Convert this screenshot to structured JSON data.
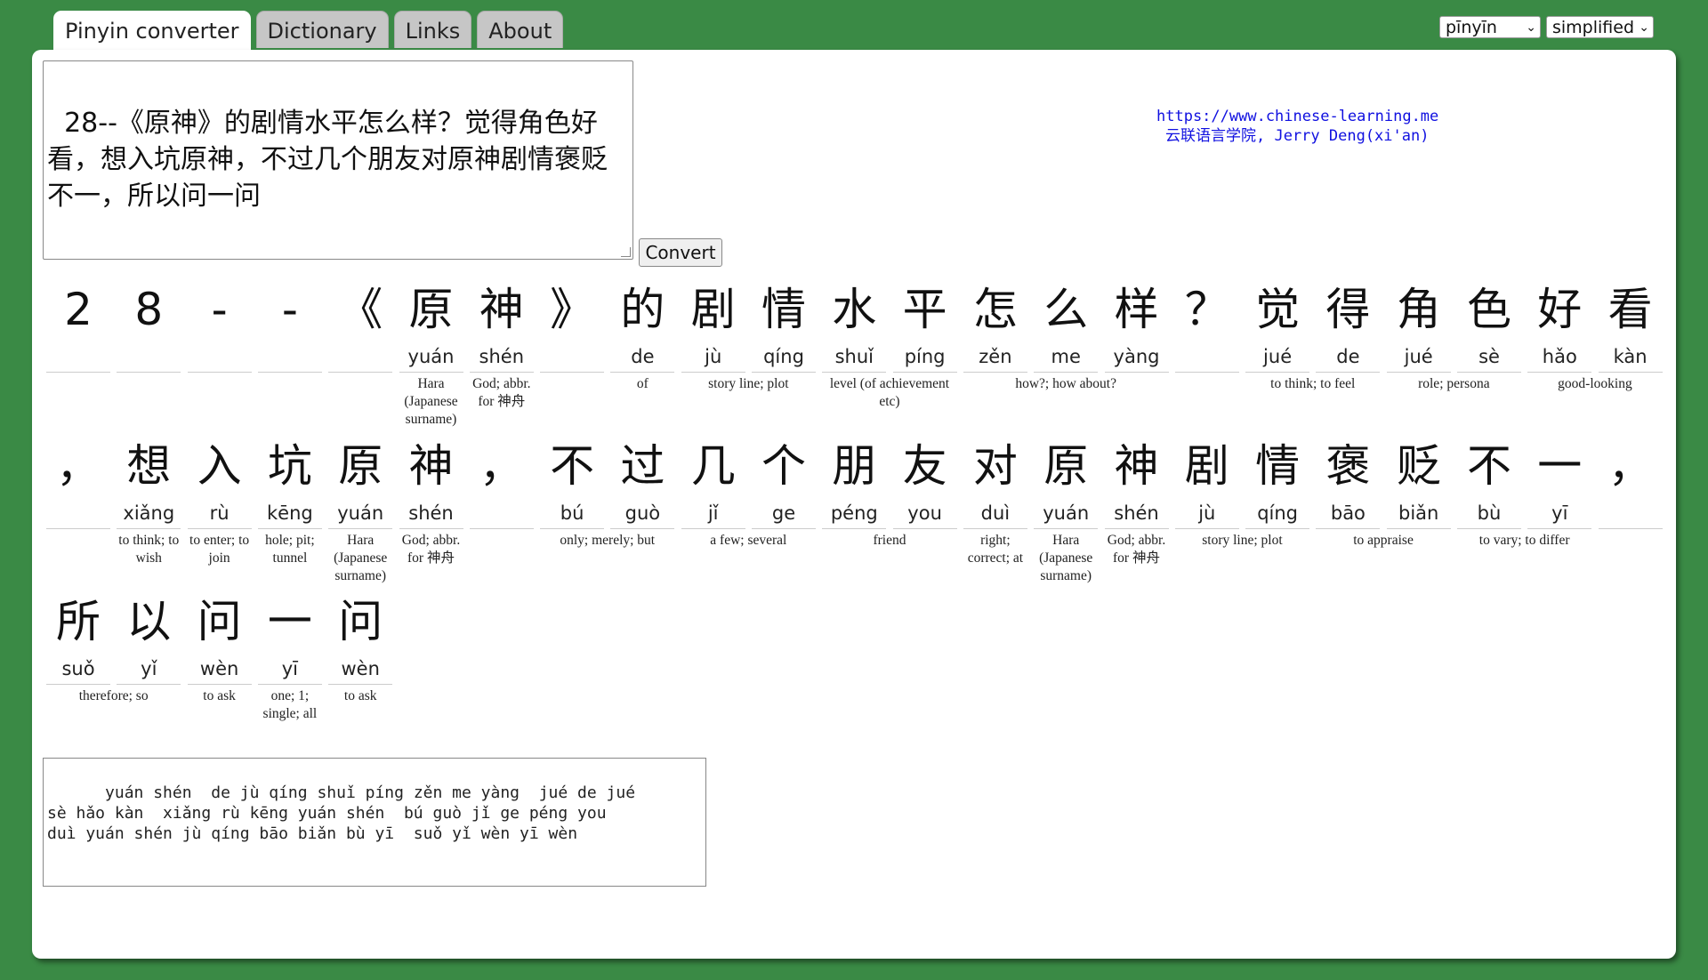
{
  "tabs": [
    {
      "label": "Pinyin converter",
      "active": true
    },
    {
      "label": "Dictionary",
      "active": false
    },
    {
      "label": "Links",
      "active": false
    },
    {
      "label": "About",
      "active": false
    }
  ],
  "settings": {
    "pinyin_mode": "pīnyīn",
    "script": "simplified"
  },
  "input_text": "28--《原神》的剧情水平怎么样？觉得角色好看，想入坑原神，不过几个朋友对原神剧情褒贬不一，所以问一问",
  "convert_label": "Convert",
  "credit": {
    "url": "https://www.chinese-learning.me",
    "name": "云联语言学院, Jerry Deng(xi'an)"
  },
  "rows": [
    {
      "cells": [
        {
          "han": "2",
          "py": ""
        },
        {
          "han": "8",
          "py": ""
        },
        {
          "han": "-",
          "py": ""
        },
        {
          "han": "-",
          "py": ""
        },
        {
          "han": "《",
          "py": ""
        },
        {
          "han": "原",
          "py": "yuán"
        },
        {
          "han": "神",
          "py": "shén"
        },
        {
          "han": "》",
          "py": ""
        },
        {
          "han": "的",
          "py": "de"
        },
        {
          "han": "剧",
          "py": "jù"
        },
        {
          "han": "情",
          "py": "qíng"
        },
        {
          "han": "水",
          "py": "shuǐ"
        },
        {
          "han": "平",
          "py": "píng"
        },
        {
          "han": "怎",
          "py": "zěn"
        },
        {
          "han": "么",
          "py": "me"
        },
        {
          "han": "样",
          "py": "yàng"
        },
        {
          "han": "？",
          "py": ""
        },
        {
          "han": "觉",
          "py": "jué"
        },
        {
          "han": "得",
          "py": "de"
        },
        {
          "han": "角",
          "py": "jué"
        },
        {
          "han": "色",
          "py": "sè"
        },
        {
          "han": "好",
          "py": "hǎo"
        },
        {
          "han": "看",
          "py": "kàn"
        }
      ],
      "glosses": [
        {
          "start": 5,
          "span": 1,
          "text": "Hara (Japanese surname)"
        },
        {
          "start": 6,
          "span": 1,
          "text": "God; abbr. for 神舟"
        },
        {
          "start": 8,
          "span": 1,
          "text": "of"
        },
        {
          "start": 9,
          "span": 2,
          "text": "story line; plot"
        },
        {
          "start": 11,
          "span": 2,
          "text": "level (of achievement etc)"
        },
        {
          "start": 13,
          "span": 3,
          "text": "how?; how about?"
        },
        {
          "start": 17,
          "span": 2,
          "text": "to think; to feel"
        },
        {
          "start": 19,
          "span": 2,
          "text": "role; persona"
        },
        {
          "start": 21,
          "span": 2,
          "text": "good-looking"
        }
      ]
    },
    {
      "cells": [
        {
          "han": "，",
          "py": ""
        },
        {
          "han": "想",
          "py": "xiǎng"
        },
        {
          "han": "入",
          "py": "rù"
        },
        {
          "han": "坑",
          "py": "kēng"
        },
        {
          "han": "原",
          "py": "yuán"
        },
        {
          "han": "神",
          "py": "shén"
        },
        {
          "han": "，",
          "py": ""
        },
        {
          "han": "不",
          "py": "bú"
        },
        {
          "han": "过",
          "py": "guò"
        },
        {
          "han": "几",
          "py": "jǐ"
        },
        {
          "han": "个",
          "py": "ge"
        },
        {
          "han": "朋",
          "py": "péng"
        },
        {
          "han": "友",
          "py": "you"
        },
        {
          "han": "对",
          "py": "duì"
        },
        {
          "han": "原",
          "py": "yuán"
        },
        {
          "han": "神",
          "py": "shén"
        },
        {
          "han": "剧",
          "py": "jù"
        },
        {
          "han": "情",
          "py": "qíng"
        },
        {
          "han": "褒",
          "py": "bāo"
        },
        {
          "han": "贬",
          "py": "biǎn"
        },
        {
          "han": "不",
          "py": "bù"
        },
        {
          "han": "一",
          "py": "yī"
        },
        {
          "han": "，",
          "py": ""
        }
      ],
      "glosses": [
        {
          "start": 1,
          "span": 1,
          "text": "to think; to wish"
        },
        {
          "start": 2,
          "span": 1,
          "text": "to enter; to join"
        },
        {
          "start": 3,
          "span": 1,
          "text": "hole; pit; tunnel"
        },
        {
          "start": 4,
          "span": 1,
          "text": "Hara (Japanese surname)"
        },
        {
          "start": 5,
          "span": 1,
          "text": "God; abbr. for 神舟"
        },
        {
          "start": 7,
          "span": 2,
          "text": "only; merely; but"
        },
        {
          "start": 9,
          "span": 2,
          "text": "a few; several"
        },
        {
          "start": 11,
          "span": 2,
          "text": "friend"
        },
        {
          "start": 13,
          "span": 1,
          "text": "right; correct; at"
        },
        {
          "start": 14,
          "span": 1,
          "text": "Hara (Japanese surname)"
        },
        {
          "start": 15,
          "span": 1,
          "text": "God; abbr. for 神舟"
        },
        {
          "start": 16,
          "span": 2,
          "text": "story line; plot"
        },
        {
          "start": 18,
          "span": 2,
          "text": "to appraise"
        },
        {
          "start": 20,
          "span": 2,
          "text": "to vary; to differ"
        }
      ]
    },
    {
      "cells": [
        {
          "han": "所",
          "py": "suǒ"
        },
        {
          "han": "以",
          "py": "yǐ"
        },
        {
          "han": "问",
          "py": "wèn"
        },
        {
          "han": "一",
          "py": "yī"
        },
        {
          "han": "问",
          "py": "wèn"
        }
      ],
      "glosses": [
        {
          "start": 0,
          "span": 2,
          "text": "therefore; so"
        },
        {
          "start": 2,
          "span": 1,
          "text": "to ask"
        },
        {
          "start": 3,
          "span": 1,
          "text": "one; 1; single; all"
        },
        {
          "start": 4,
          "span": 1,
          "text": "to ask"
        }
      ]
    }
  ],
  "output_text": "    yuán shén  de jù qíng shuǐ píng zěn me yàng  jué de jué\nsè hǎo kàn  xiǎng rù kēng yuán shén  bú guò jǐ ge péng you\nduì yuán shén jù qíng bāo biǎn bù yī  suǒ yǐ wèn yī wèn"
}
